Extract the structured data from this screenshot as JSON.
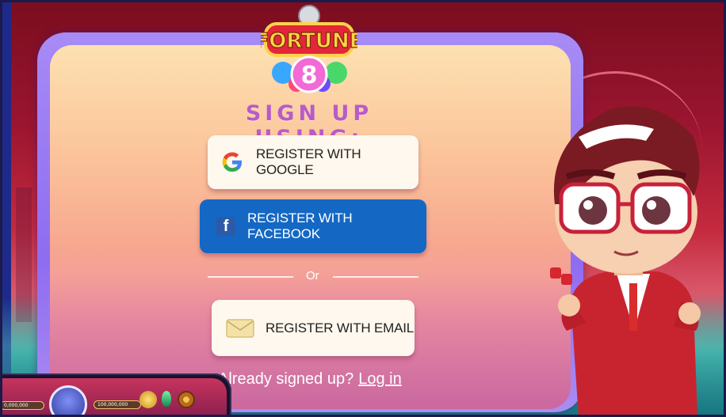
{
  "brand": {
    "logo_text": "FORTUNE",
    "logo_number": "8"
  },
  "signup": {
    "title": "SIGN UP USING:",
    "google_label": "REGISTER WITH GOOGLE",
    "facebook_label": "REGISTER WITH FACEBOOK",
    "or_label": "Or",
    "email_label": "REGISTER WITH EMAIL",
    "already_text": "Already signed up?",
    "login_label": "Log in"
  },
  "hud": {
    "left_balance": "0,000,000",
    "right_balance": "100,000,000"
  },
  "colors": {
    "title": "#b85bc8",
    "facebook_blue": "#1468c4",
    "card_border": "#8f6cf0",
    "button_light": "#fff8ee"
  },
  "icons": {
    "google": "google-g-icon",
    "facebook": "facebook-f-icon",
    "email": "envelope-icon",
    "coin": "coin-icon",
    "gem": "green-gem-icon",
    "settings": "gear-icon"
  }
}
